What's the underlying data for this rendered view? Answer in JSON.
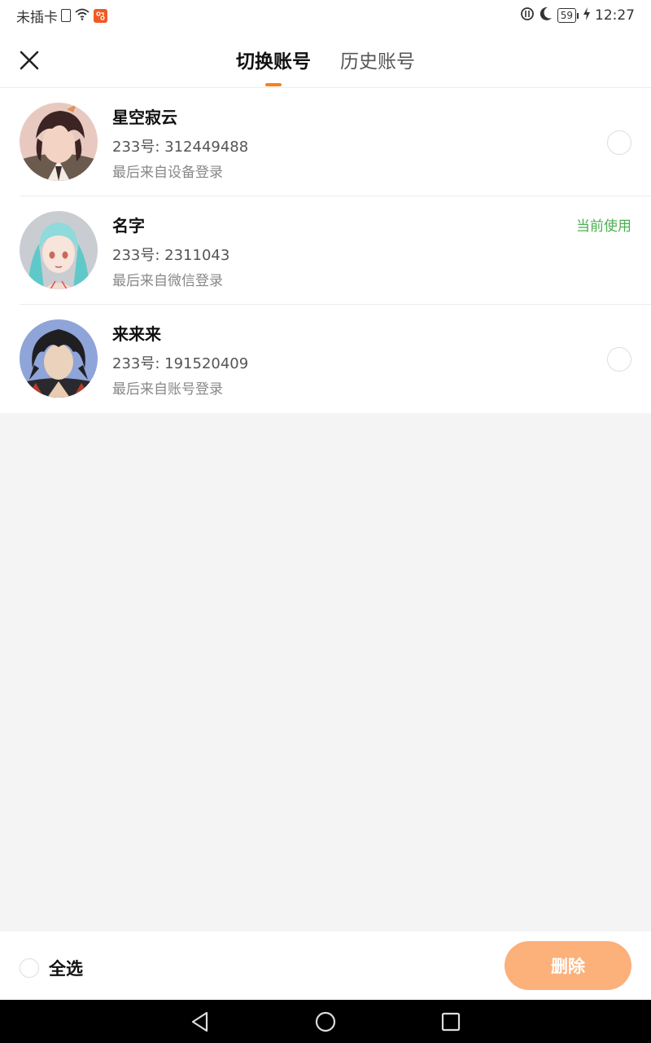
{
  "status_bar": {
    "carrier": "未插卡",
    "time": "12:27",
    "battery": "59"
  },
  "header": {
    "tabs": [
      {
        "label": "切换账号",
        "active": true
      },
      {
        "label": "历史账号",
        "active": false
      }
    ]
  },
  "accounts": [
    {
      "name": "星空寂云",
      "uid": "233号: 312449488",
      "login": "最后来自设备登录",
      "current": false
    },
    {
      "name": "名字",
      "uid": "233号: 2311043",
      "login": "最后来自微信登录",
      "current": true,
      "current_label": "当前使用"
    },
    {
      "name": "来来来",
      "uid": "233号: 191520409",
      "login": "最后来自账号登录",
      "current": false
    }
  ],
  "footer": {
    "select_all_label": "全选",
    "delete_label": "删除"
  },
  "colors": {
    "accent": "#f58220",
    "delete_button": "#fcb07a",
    "current_tag": "#4caf50"
  },
  "icons": [
    "close-icon",
    "wifi-icon",
    "sim-icon",
    "moon-icon",
    "battery-icon",
    "back-icon",
    "home-icon",
    "recents-icon"
  ]
}
